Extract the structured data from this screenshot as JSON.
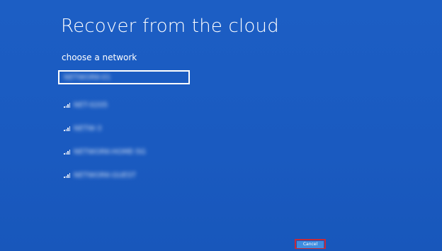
{
  "page": {
    "title": "Recover from the cloud",
    "subtitle": "choose a network"
  },
  "networks": [
    {
      "ssid": "NETWORK-01",
      "selected": true,
      "icon": "wifi-signal-icon"
    },
    {
      "ssid": "NET-0205",
      "selected": false,
      "icon": "wifi-signal-icon"
    },
    {
      "ssid": "NETW-3",
      "selected": false,
      "icon": "wifi-signal-icon"
    },
    {
      "ssid": "NETWORK-HOME-5G",
      "selected": false,
      "icon": "wifi-signal-icon"
    },
    {
      "ssid": "NETWORK-GUEST",
      "selected": false,
      "icon": "wifi-signal-icon"
    }
  ],
  "footer": {
    "cancel_label": "Cancel"
  },
  "colors": {
    "background": "#1a5bc1",
    "button": "#3f8de0",
    "highlight": "#c42b3a"
  }
}
